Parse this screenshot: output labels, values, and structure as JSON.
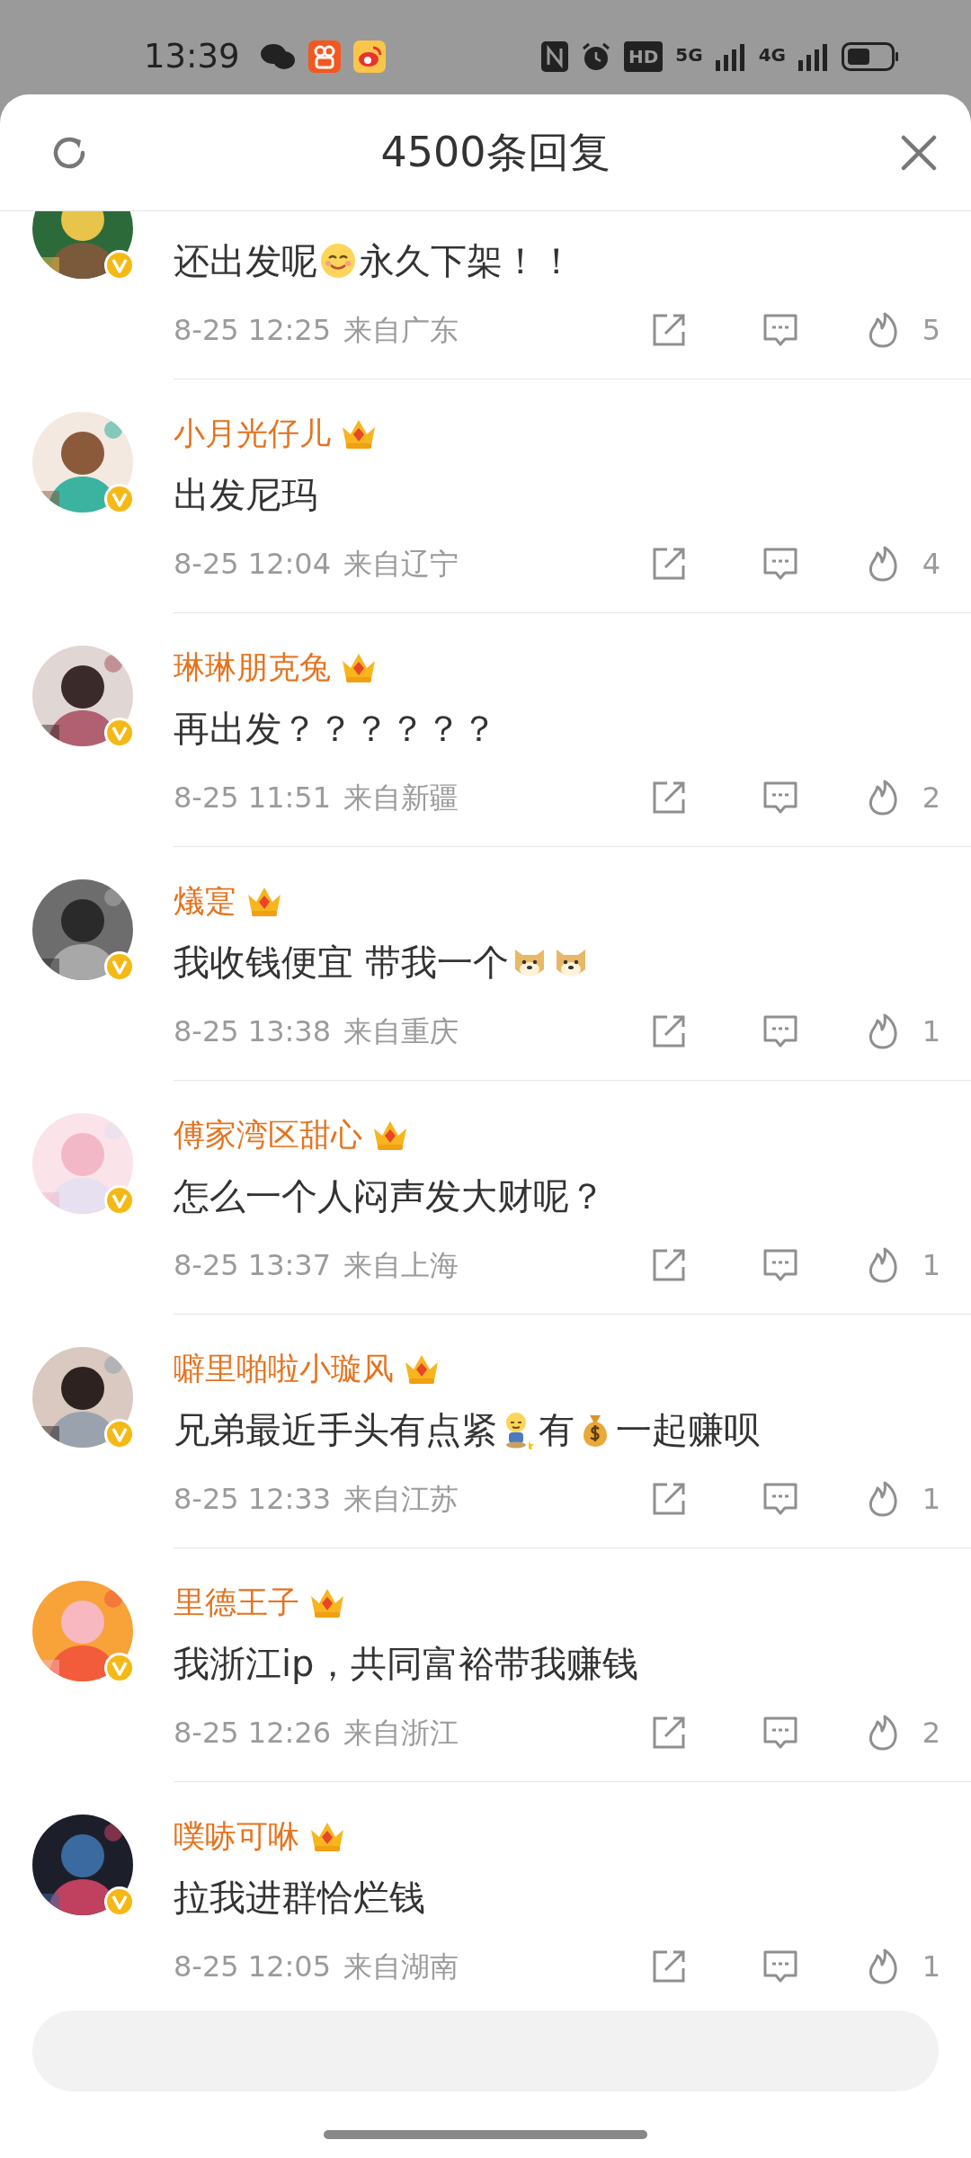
{
  "status_bar": {
    "time": "13:39",
    "indicators": [
      "HD",
      "5G",
      "4G"
    ]
  },
  "header": {
    "title": "4500条回复"
  },
  "comments": [
    {
      "segments": [
        {
          "kind": "text",
          "text": "还出发呢"
        },
        {
          "kind": "smile"
        },
        {
          "kind": "text",
          "text": "永久下架！！"
        }
      ],
      "date": "8-25 12:25",
      "location": "来自广东",
      "likes": "5"
    },
    {
      "name": "小月光仔儿",
      "segments": [
        {
          "kind": "text",
          "text": "出发尼玛"
        }
      ],
      "date": "8-25 12:04",
      "location": "来自辽宁",
      "likes": "4"
    },
    {
      "name": "琳琳朋克兔",
      "segments": [
        {
          "kind": "text",
          "text": "再出发？？？？？？"
        }
      ],
      "date": "8-25 11:51",
      "location": "来自新疆",
      "likes": "2"
    },
    {
      "name": "燨寔",
      "segments": [
        {
          "kind": "text",
          "text": "我收钱便宜 带我一个"
        },
        {
          "kind": "doge"
        },
        {
          "kind": "doge"
        }
      ],
      "date": "8-25 13:38",
      "location": "来自重庆",
      "likes": "1"
    },
    {
      "name": "傅家湾区甜心",
      "segments": [
        {
          "kind": "text",
          "text": "怎么一个人闷声发大财呢？"
        }
      ],
      "date": "8-25 13:37",
      "location": "来自上海",
      "likes": "1"
    },
    {
      "name": "噼里啪啦小璇风",
      "segments": [
        {
          "kind": "text",
          "text": "兄弟最近手头有点紧"
        },
        {
          "kind": "weary"
        },
        {
          "kind": "text",
          "text": "有"
        },
        {
          "kind": "money"
        },
        {
          "kind": "text",
          "text": "一起赚呗"
        }
      ],
      "date": "8-25 12:33",
      "location": "来自江苏",
      "likes": "1"
    },
    {
      "name": "里德王子",
      "segments": [
        {
          "kind": "text",
          "text": "我浙江ip，共同富裕带我赚钱"
        }
      ],
      "date": "8-25 12:26",
      "location": "来自浙江",
      "likes": "2"
    },
    {
      "name": "噗哧可咻",
      "segments": [
        {
          "kind": "text",
          "text": "拉我进群恰烂钱"
        }
      ],
      "date": "8-25 12:05",
      "location": "来自湖南",
      "likes": "1"
    }
  ]
}
